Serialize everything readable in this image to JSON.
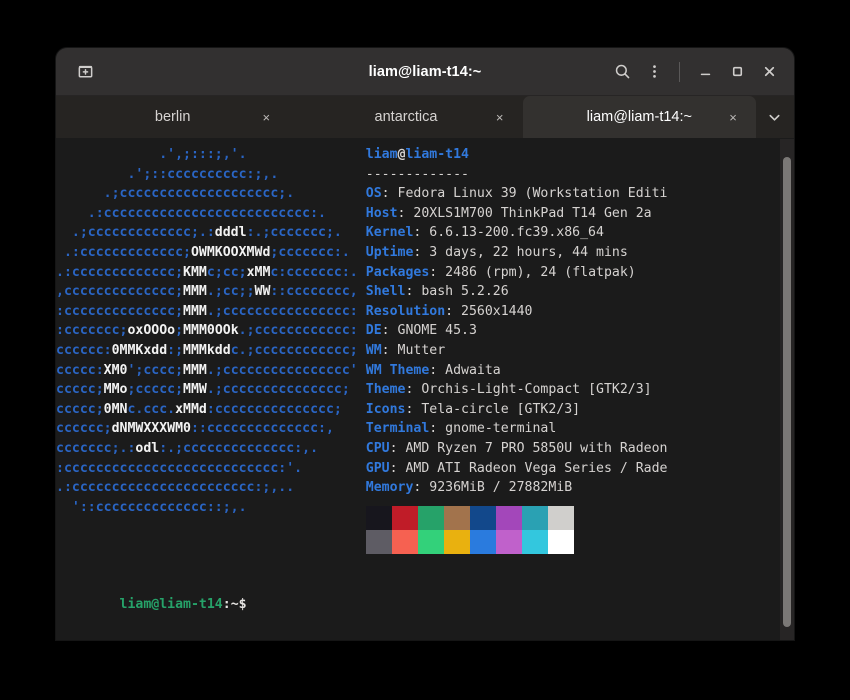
{
  "window": {
    "title": "liam@liam-t14:~",
    "new_terminal_icon": "new-terminal-icon",
    "search_icon": "search-icon",
    "menu_icon": "hamburger-menu-icon",
    "minimize_icon": "minimize-icon",
    "maximize_icon": "maximize-icon",
    "close_icon": "close-icon"
  },
  "tabs": {
    "items": [
      {
        "label": "berlin",
        "close": "×",
        "active": false
      },
      {
        "label": "antarctica",
        "close": "×",
        "active": false
      },
      {
        "label": "liam@liam-t14:~",
        "close": "×",
        "active": true
      }
    ],
    "dropdown_icon": "chevron-down-icon"
  },
  "terminal": {
    "ascii_art_lines": [
      "             .',;:::;,'.",
      "         .';::cccccccccc:;,.",
      "      .;cccccccccccccccccccc;.",
      "    .:cccccccccccccccccccccccccc:.",
      "  .;ccccccccccccc;.:dddl:.;ccccccc;.",
      " .:ccccccccccccc;OWMKOOXMWd;ccccccc:.",
      ".:ccccccccccccc;KMMc;cc;xMMc:ccccccc:.",
      ",cccccccccccccc;MMM.;cc;;WW::cccccccc,",
      ":cccccccccccccc;MMM.;cccccccccccccccc:",
      ":ccccccc;oxOOOo;MMM0OOk.;cccccccccccc:",
      "cccccc:0MMKxdd:;MMMkddc.;cccccccccccc;",
      "ccccc:XM0';cccc;MMM.;cccccccccccccccc'",
      "ccccc;MMo;ccccc;MMW.;ccccccccccccccc;",
      "ccccc;0MNc.ccc.xMMd:ccccccccccccccc;",
      "cccccc;dNMWXXXWM0::cccccccccccccc:,",
      "ccccccc;.:odl:.;cccccccccccccc:,.",
      ":ccccccccccccccccccccccccccc:'.",
      ".:ccccccccccccccccccccccc:;,..",
      "  '::cccccccccccccc::;,."
    ],
    "ascii_white_segments": "OWMKOOXMWd KMMc xMMc MMM WW oxOOOo MMM0OOk 0MMKxdd MMMkddc XM0 MMo MMW 0MNc xMMd dNMWXXXWM0 odl",
    "host_line": {
      "user": "liam",
      "at": "@",
      "host": "liam-t14"
    },
    "separator": "-------------",
    "info": [
      {
        "label": "OS",
        "value": "Fedora Linux 39 (Workstation Editi"
      },
      {
        "label": "Host",
        "value": "20XLS1M700 ThinkPad T14 Gen 2a"
      },
      {
        "label": "Kernel",
        "value": "6.6.13-200.fc39.x86_64"
      },
      {
        "label": "Uptime",
        "value": "3 days, 22 hours, 44 mins"
      },
      {
        "label": "Packages",
        "value": "2486 (rpm), 24 (flatpak)"
      },
      {
        "label": "Shell",
        "value": "bash 5.2.26"
      },
      {
        "label": "Resolution",
        "value": "2560x1440"
      },
      {
        "label": "DE",
        "value": "GNOME 45.3"
      },
      {
        "label": "WM",
        "value": "Mutter"
      },
      {
        "label": "WM Theme",
        "value": "Adwaita"
      },
      {
        "label": "Theme",
        "value": "Orchis-Light-Compact [GTK2/3]"
      },
      {
        "label": "Icons",
        "value": "Tela-circle [GTK2/3]"
      },
      {
        "label": "Terminal",
        "value": "gnome-terminal"
      },
      {
        "label": "CPU",
        "value": "AMD Ryzen 7 PRO 5850U with Radeon"
      },
      {
        "label": "GPU",
        "value": "AMD ATI Radeon Vega Series / Rade"
      },
      {
        "label": "Memory",
        "value": "9236MiB / 27882MiB"
      }
    ],
    "palette": {
      "row1": [
        "#17161d",
        "#c01c28",
        "#26a269",
        "#a2734c",
        "#12488b",
        "#a347ba",
        "#2aa1b3",
        "#d0cfcc"
      ],
      "row2": [
        "#5e5c64",
        "#f66151",
        "#33d17a",
        "#e9b10f",
        "#2a7bde",
        "#c061cb",
        "#33c7de",
        "#ffffff"
      ]
    },
    "prompt": {
      "user_host": "liam@liam-t14",
      "path": ":~$"
    },
    "colors": {
      "background": "#1b1b1b",
      "foreground": "#d6d3d1",
      "label_blue": "#3179dd",
      "ascii_blue": "#2a65c4",
      "prompt_green": "#26a269"
    }
  }
}
